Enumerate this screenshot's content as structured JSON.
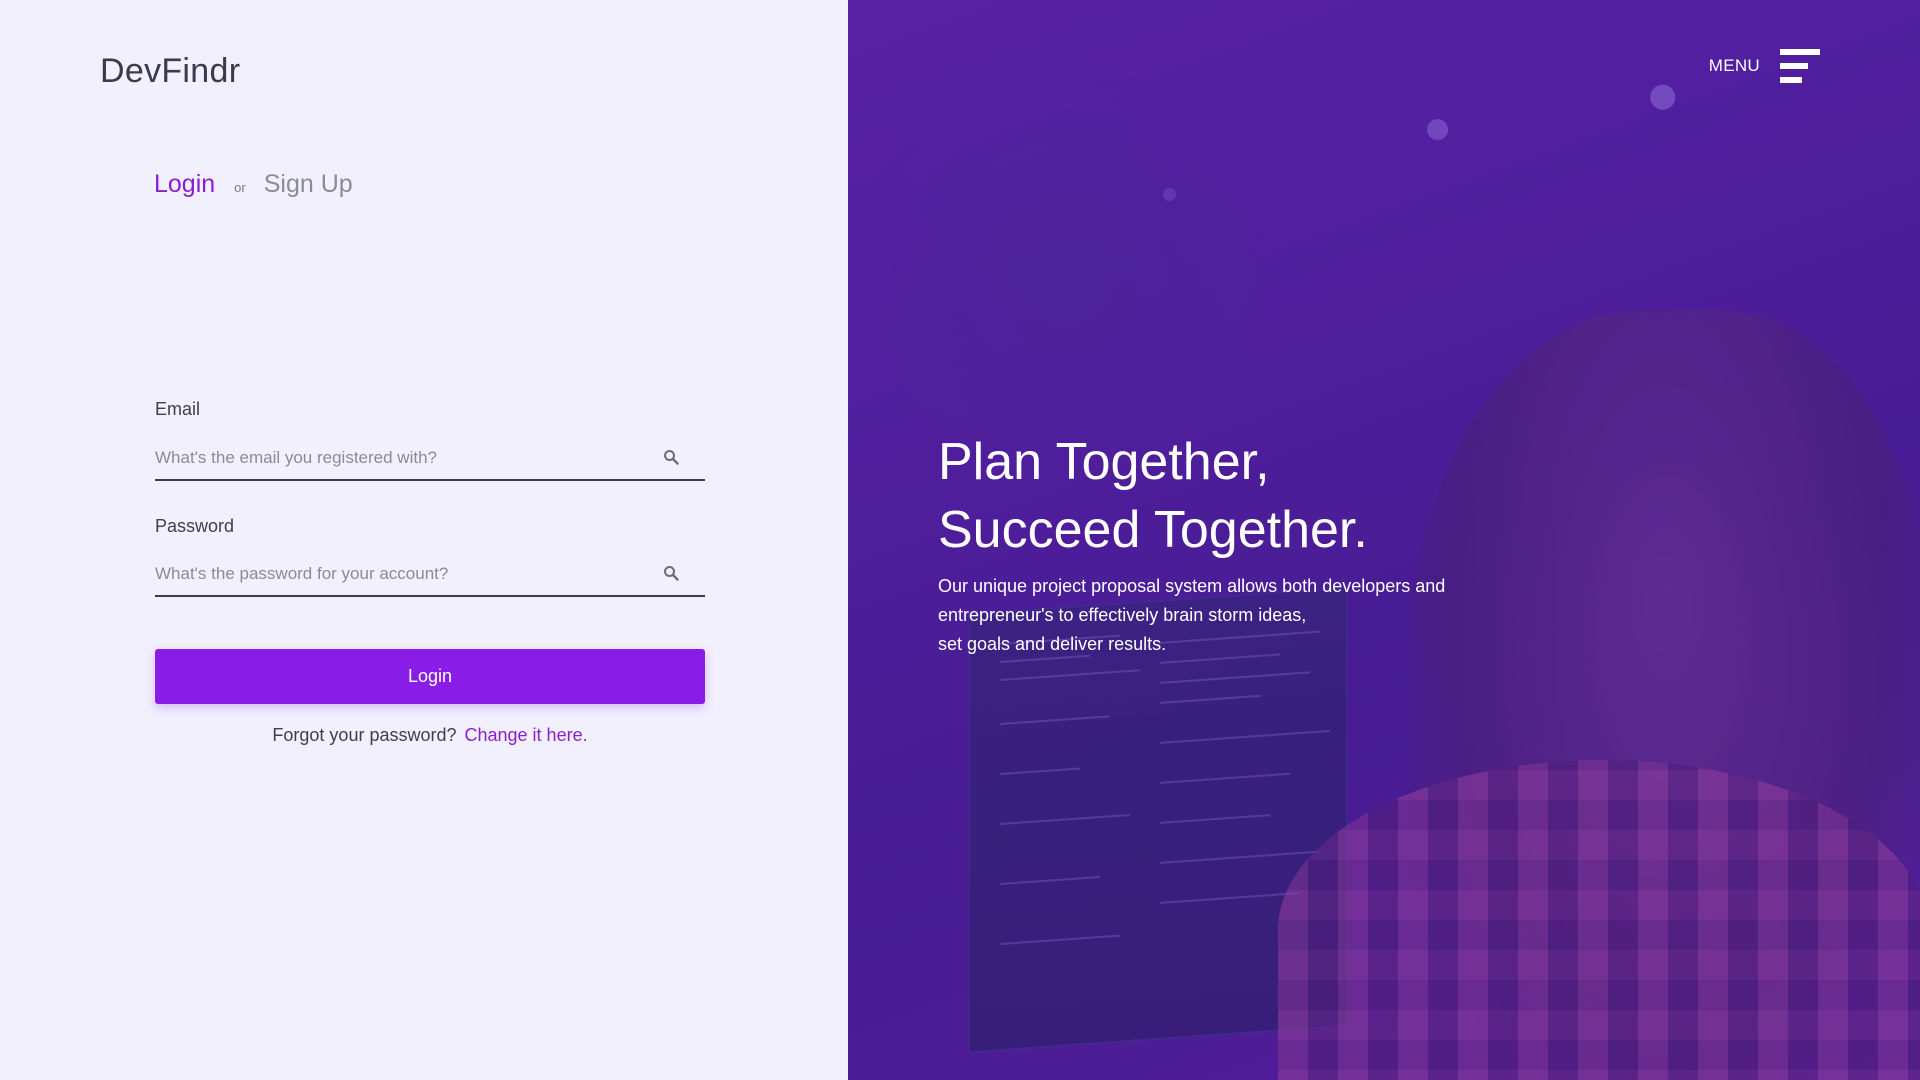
{
  "brand": "DevFindr",
  "auth_tabs": {
    "login": "Login",
    "or": "or",
    "signup": "Sign Up"
  },
  "form": {
    "email": {
      "label": "Email",
      "placeholder": "What's the email you registered with?",
      "icon": "search-icon"
    },
    "password": {
      "label": "Password",
      "placeholder": "What's the password for your account?",
      "icon": "search-icon"
    },
    "submit_label": "Login",
    "forgot_text": "Forgot your password?",
    "forgot_link": "Change it here."
  },
  "hero": {
    "menu_label": "MENU",
    "menu_icon": "hamburger-menu-icon",
    "headline_line1": "Plan Together,",
    "headline_line2": "Succeed Together.",
    "sub_line1": "Our unique project proposal system allows both developers and",
    "sub_line2": "entrepreneur's to effectively brain storm ideas,",
    "sub_line3": "set goals and deliver results."
  },
  "colors": {
    "accent": "#8a1ce8",
    "left_bg": "#f1f0fc",
    "hero_overlay": "#5420aa",
    "text_dark": "#3c3b4a"
  }
}
